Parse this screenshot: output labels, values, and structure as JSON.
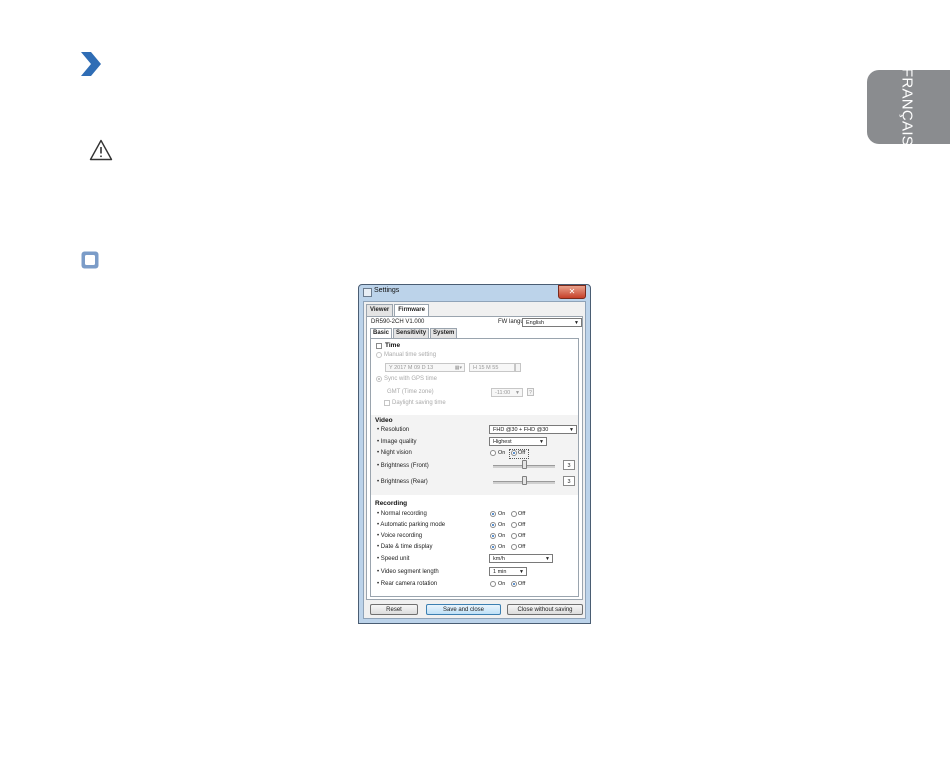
{
  "page": {
    "side_tab_text": "FRANÇAIS"
  },
  "window": {
    "title": "Settings",
    "close_glyph": "✕",
    "tabs": [
      {
        "label": "Viewer",
        "active": false
      },
      {
        "label": "Firmware",
        "active": true
      }
    ],
    "model_version": "DR590-2CH  V1.000",
    "fw_language_label": "FW language",
    "fw_language_value": "English",
    "subtabs": [
      {
        "label": "Basic",
        "active": true
      },
      {
        "label": "Sensitivity",
        "active": false
      },
      {
        "label": "System",
        "active": false
      }
    ],
    "time": {
      "header": "Time",
      "manual_label": "Manual time setting",
      "date_value": "Y 2017 M 09 D 13",
      "time_value": "H 15 M 55",
      "sync_label": "Sync with GPS time",
      "gmt_label": "GMT (Time zone)",
      "gmt_value": "-11:00",
      "help_glyph": "?",
      "dst_label": "Daylight saving time"
    },
    "video": {
      "header": "Video",
      "resolution_label": "• Resolution",
      "resolution_value": "FHD @30 + FHD @30",
      "quality_label": "• Image quality",
      "quality_value": "Highest",
      "night_label": "• Night vision",
      "night_on": "On",
      "night_off": "Off",
      "night_state": "off",
      "bright_front_label": "• Brightness (Front)",
      "bright_front_value": "3",
      "bright_front_level": 0.5,
      "bright_rear_label": "• Brightness (Rear)",
      "bright_rear_value": "3",
      "bright_rear_level": 0.5
    },
    "recording": {
      "header": "Recording",
      "on_label": "On",
      "off_label": "Off",
      "items": [
        {
          "label": "• Normal recording",
          "state": "on"
        },
        {
          "label": "• Automatic parking mode",
          "state": "on"
        },
        {
          "label": "• Voice recording",
          "state": "on"
        },
        {
          "label": "• Date & time display",
          "state": "on"
        }
      ],
      "speed_label": "• Speed unit",
      "speed_value": "km/h",
      "segment_label": "• Video segment length",
      "segment_value": "1 min",
      "rear_rot_label": "• Rear camera rotation",
      "rear_rot_state": "off"
    },
    "buttons": {
      "reset": "Reset",
      "save": "Save and close",
      "close": "Close without saving"
    },
    "colors": {
      "chevron": "#2f6db5",
      "square": "#7b9cc8",
      "side_tab": "#8a8c8f"
    }
  }
}
